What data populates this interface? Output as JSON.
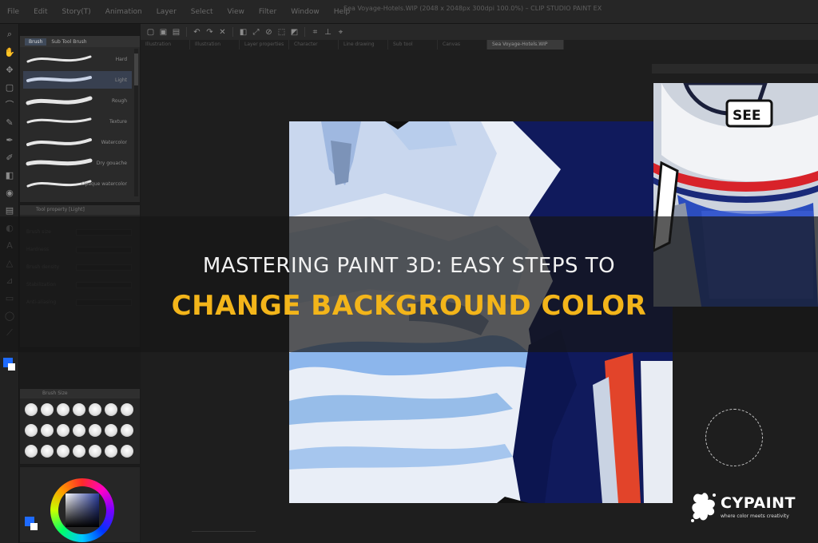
{
  "window": {
    "title": "Sea Voyage-Hotels.WIP (2048 x 2048px 300dpi 100.0%) – CLIP STUDIO PAINT EX"
  },
  "menu": {
    "items": [
      "File",
      "Edit",
      "Story(T)",
      "Animation",
      "Layer",
      "Select",
      "View",
      "Filter",
      "Window",
      "Help"
    ]
  },
  "toolbar": {
    "buttons": [
      "new-icon",
      "open-icon",
      "save-icon",
      "undo-icon",
      "redo-icon",
      "clear-icon",
      "fill-icon",
      "transform-icon",
      "deselect-icon",
      "select-all-icon",
      "invert-icon",
      "crop-icon",
      "ruler-icon",
      "snap-icon"
    ]
  },
  "tabs": [
    "Illustration",
    "Illustration",
    "Layer properties",
    "Character",
    "Line drawing",
    "Sub tool",
    "Canvas",
    "Sea Voyage-Hotels.WIP"
  ],
  "sub_tool_panel": {
    "tabs": [
      "Brush",
      "Sub Tool Brush"
    ],
    "brushes": [
      "Hard",
      "Light",
      "Rough",
      "Texture",
      "Watercolor",
      "Dry gouache",
      "Opaque watercolor"
    ]
  },
  "tool_property": {
    "header": "Tool property [Light]",
    "rows": [
      "Brush size",
      "Hardness",
      "Brush density",
      "Stabilization",
      "Anti-aliasing"
    ]
  },
  "brush_size_panel": {
    "header": "Brush Size"
  },
  "overlay": {
    "headline_line1": "MASTERING PAINT 3D: EASY STEPS TO",
    "headline_line2": "CHANGE BACKGROUND COLOR"
  },
  "brand": {
    "name": "CYPAINT",
    "tagline": "where color meets creativity"
  },
  "colors": {
    "accent": "#f3b51a",
    "main_color": "#1e6bff",
    "ui_bg": "#1b1b1b",
    "art_navy": "#101a5c",
    "art_red": "#e2442a",
    "art_light_blue": "#8cb6ec"
  }
}
